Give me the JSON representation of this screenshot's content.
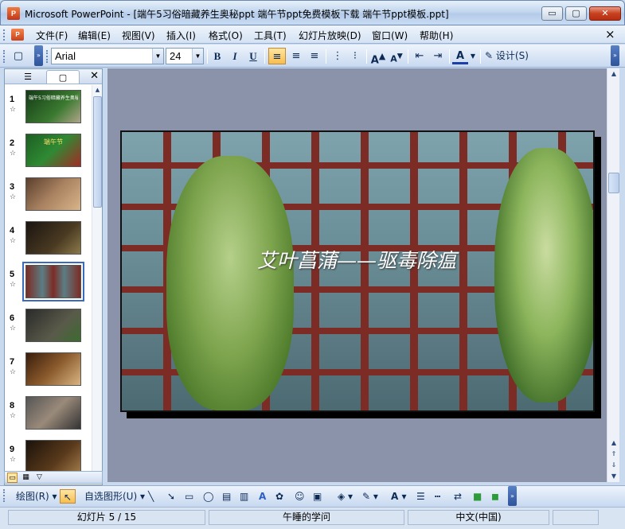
{
  "window": {
    "app_icon": "P",
    "title": "Microsoft PowerPoint - [端午5习俗暗藏养生奥秘ppt 端午节ppt免费模板下载  端午节ppt模板.ppt]",
    "min_glyph": "▭",
    "max_glyph": "▢",
    "close_glyph": "✕"
  },
  "menubar": {
    "doc_icon": "P",
    "items": [
      "文件(F)",
      "编辑(E)",
      "视图(V)",
      "插入(I)",
      "格式(O)",
      "工具(T)",
      "幻灯片放映(D)",
      "窗口(W)",
      "帮助(H)"
    ],
    "close_glyph": "×"
  },
  "toolbar": {
    "font_name": "Arial",
    "font_size": "24",
    "bold": "B",
    "italic": "I",
    "underline": "U",
    "font_color": "A",
    "design_label": "设计(S)"
  },
  "left_panel": {
    "tabs": [
      "☰",
      "▢"
    ],
    "close_glyph": "✕",
    "slides": [
      {
        "num": "1",
        "thumb_text": "端午5习俗暗藏养生奥秘"
      },
      {
        "num": "2",
        "thumb_text": "端午节"
      },
      {
        "num": "3",
        "thumb_text": ""
      },
      {
        "num": "4",
        "thumb_text": ""
      },
      {
        "num": "5",
        "thumb_text": ""
      },
      {
        "num": "6",
        "thumb_text": ""
      },
      {
        "num": "7",
        "thumb_text": ""
      },
      {
        "num": "8",
        "thumb_text": ""
      },
      {
        "num": "9",
        "thumb_text": ""
      }
    ],
    "selected_slide": "5"
  },
  "slide": {
    "caption": "艾叶菖蒲——驱毒除瘟"
  },
  "drawbar": {
    "draw_label": "绘图(R)",
    "autoshape_label": "自选图形(U)"
  },
  "statusbar": {
    "slide_info": "幻灯片 5 / 15",
    "design_name": "午睡的学问",
    "language": "中文(中国)"
  },
  "colors": {
    "titlebar": "#c3d7ef",
    "accent": "#3b6bbd",
    "slide_frame": "#7c2c24"
  }
}
